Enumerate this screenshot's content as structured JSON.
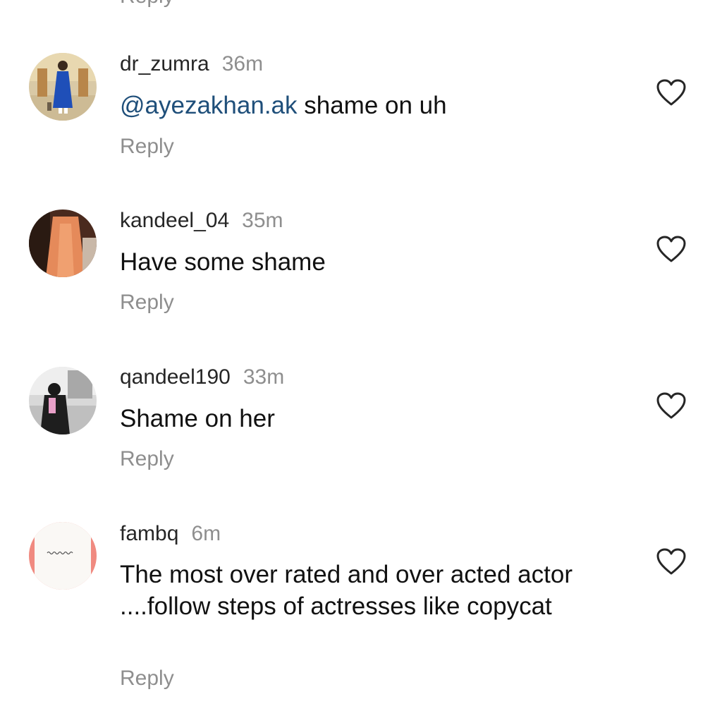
{
  "top_partial_reply": "Reply",
  "comments": [
    {
      "username": "dr_zumra",
      "time": "36m",
      "mention": "@ayezakhan.ak",
      "text": " shame on uh",
      "reply_label": "Reply",
      "like_icon": "heart-outline-icon"
    },
    {
      "username": "kandeel_04",
      "time": "35m",
      "mention": "",
      "text": "Have some shame",
      "reply_label": "Reply",
      "like_icon": "heart-outline-icon"
    },
    {
      "username": "qandeel190",
      "time": "33m",
      "mention": "",
      "text": "Shame on her",
      "reply_label": "Reply",
      "like_icon": "heart-outline-icon"
    },
    {
      "username": "fambq",
      "time": "6m",
      "mention": "",
      "text": "The most over rated and over acted actor ....follow steps of actresses like copycat",
      "reply_label": "Reply",
      "like_icon": "heart-outline-icon"
    }
  ],
  "colors": {
    "mention": "#1f4f7a",
    "secondary_text": "#8e8e8e",
    "primary_text": "#111111"
  }
}
